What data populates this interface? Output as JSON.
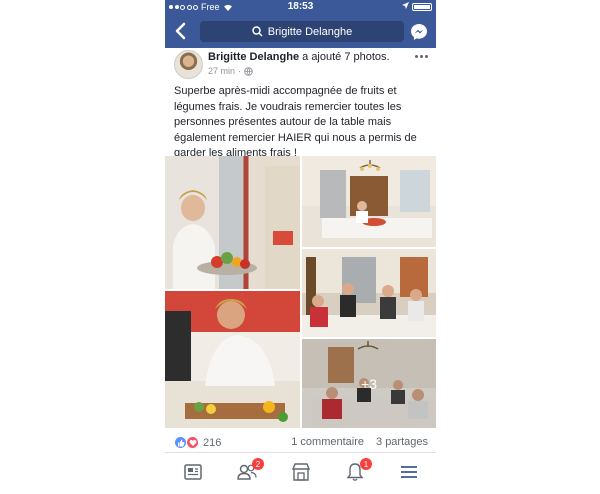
{
  "status_bar": {
    "carrier": "Free",
    "time": "18:53"
  },
  "nav": {
    "search_text": "Brigitte Delanghe"
  },
  "post": {
    "author": "Brigitte Delanghe",
    "action": "a ajouté 7 photos.",
    "time": "27 min",
    "text": "Superbe après-midi accompagnée de fruits et légumes frais. Je voudrais remercier toutes les personnes présentes autour de la table mais également remercier HAIER qui nous a permis de garder les aliments frais !",
    "more_photos": "+3",
    "reaction_count": "216",
    "comments": "1 commentaire",
    "shares": "3 partages"
  },
  "tabs": {
    "friend_requests_badge": "2",
    "notifications_badge": "1"
  },
  "colors": {
    "brand": "#3b5998",
    "badge": "#fa3e3e"
  }
}
